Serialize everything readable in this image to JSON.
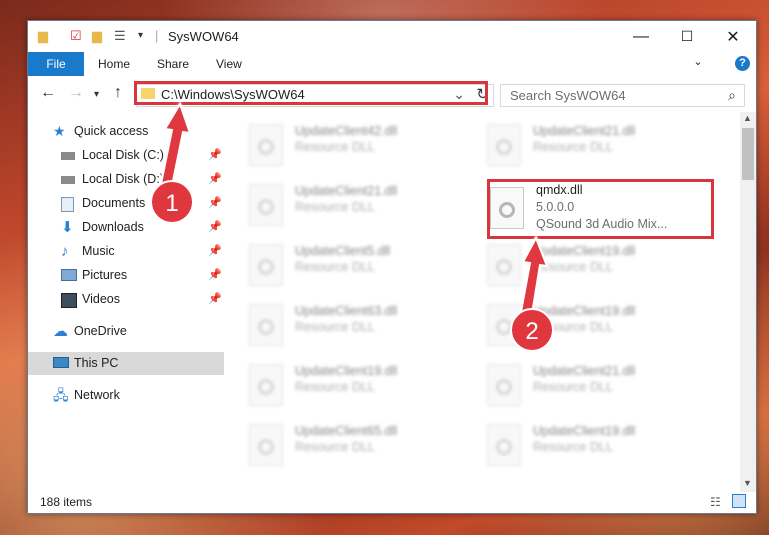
{
  "window": {
    "title": "SysWOW64",
    "minimize": "—",
    "maximize": "☐",
    "close": "✕"
  },
  "ribbon": {
    "file": "File",
    "home": "Home",
    "share": "Share",
    "view": "View",
    "help": "?"
  },
  "address": {
    "path": "C:\\Windows\\SysWOW64",
    "search_placeholder": "Search SysWOW64"
  },
  "sidebar": {
    "items": [
      {
        "label": "Quick access",
        "icon": "star-icon",
        "pinned": false
      },
      {
        "label": "Local Disk (C:)",
        "icon": "drive-icon",
        "pinned": true
      },
      {
        "label": "Local Disk (D:)",
        "icon": "drive-icon",
        "pinned": true
      },
      {
        "label": "Documents",
        "icon": "documents-icon",
        "pinned": true
      },
      {
        "label": "Downloads",
        "icon": "download-icon",
        "pinned": true
      },
      {
        "label": "Music",
        "icon": "music-icon",
        "pinned": true
      },
      {
        "label": "Pictures",
        "icon": "pictures-icon",
        "pinned": true
      },
      {
        "label": "Videos",
        "icon": "videos-icon",
        "pinned": true
      },
      {
        "label": "OneDrive",
        "icon": "cloud-icon",
        "pinned": false
      },
      {
        "label": "This PC",
        "icon": "computer-icon",
        "pinned": false
      },
      {
        "label": "Network",
        "icon": "network-icon",
        "pinned": false
      }
    ]
  },
  "files": [
    {
      "name": "UpdateClient42.dll",
      "desc": "Resource DLL"
    },
    {
      "name": "UpdateClient21.dll",
      "desc": "Resource DLL"
    },
    {
      "name": "UpdateClient21.dll",
      "desc": "Resource DLL"
    },
    {
      "name": "qmdx.dll",
      "version": "5.0.0.0",
      "desc": "QSound 3d Audio Mix..."
    },
    {
      "name": "UpdateClient5.dll",
      "desc": "Resource DLL"
    },
    {
      "name": "UpdateClient19.dll",
      "desc": "Resource DLL"
    },
    {
      "name": "UpdateClient63.dll",
      "desc": "Resource DLL"
    },
    {
      "name": "UpdateClient19.dll",
      "desc": "Resource DLL"
    },
    {
      "name": "UpdateClient19.dll",
      "desc": "Resource DLL"
    },
    {
      "name": "UpdateClient21.dll",
      "desc": "Resource DLL"
    },
    {
      "name": "UpdateClient65.dll",
      "desc": "Resource DLL"
    },
    {
      "name": "UpdateClient19.dll",
      "desc": "Resource DLL"
    }
  ],
  "status": {
    "count": "188 items"
  },
  "annotations": {
    "step1": "1",
    "step2": "2",
    "color": "#d9353d"
  }
}
